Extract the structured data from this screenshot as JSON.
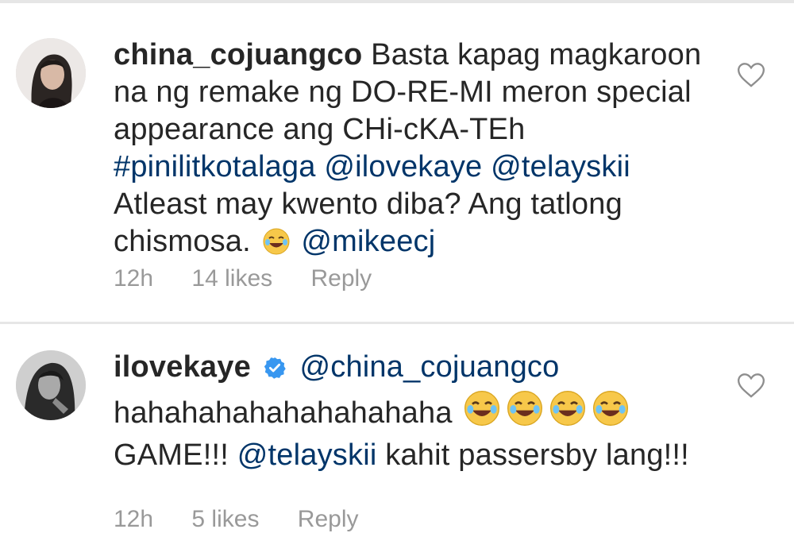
{
  "comments": [
    {
      "username": "china_cojuangco",
      "text_1": "Basta kapag magkaroon na ng remake ng DO-RE-MI meron special appearance ang CHi-cKA-TEh",
      "hashtag": "#pinilitkotalaga",
      "mention_1": "@ilovekaye",
      "mention_2": "@telayskii",
      "text_2": "Atleast may kwento diba? Ang tatlong chismosa.",
      "emoji": "face-with-tears-of-joy",
      "mention_3": "@mikeecj",
      "time": "12h",
      "likes": "14 likes",
      "reply_label": "Reply"
    },
    {
      "username": "ilovekaye",
      "verified": true,
      "mention_1": "@china_cojuangco",
      "text_1": "hahahahahahahahahaha",
      "emoji": "face-with-tears-of-joy",
      "emoji_count": 4,
      "text_2": "GAME!!!",
      "mention_2": "@telayskii",
      "text_3": "kahit passersby lang!!!",
      "time": "12h",
      "likes": "5 likes",
      "reply_label": "Reply"
    }
  ],
  "colors": {
    "text": "#262626",
    "mention": "#003569",
    "meta": "#999999",
    "verified": "#3897f0",
    "divider": "#e6e6e6"
  }
}
